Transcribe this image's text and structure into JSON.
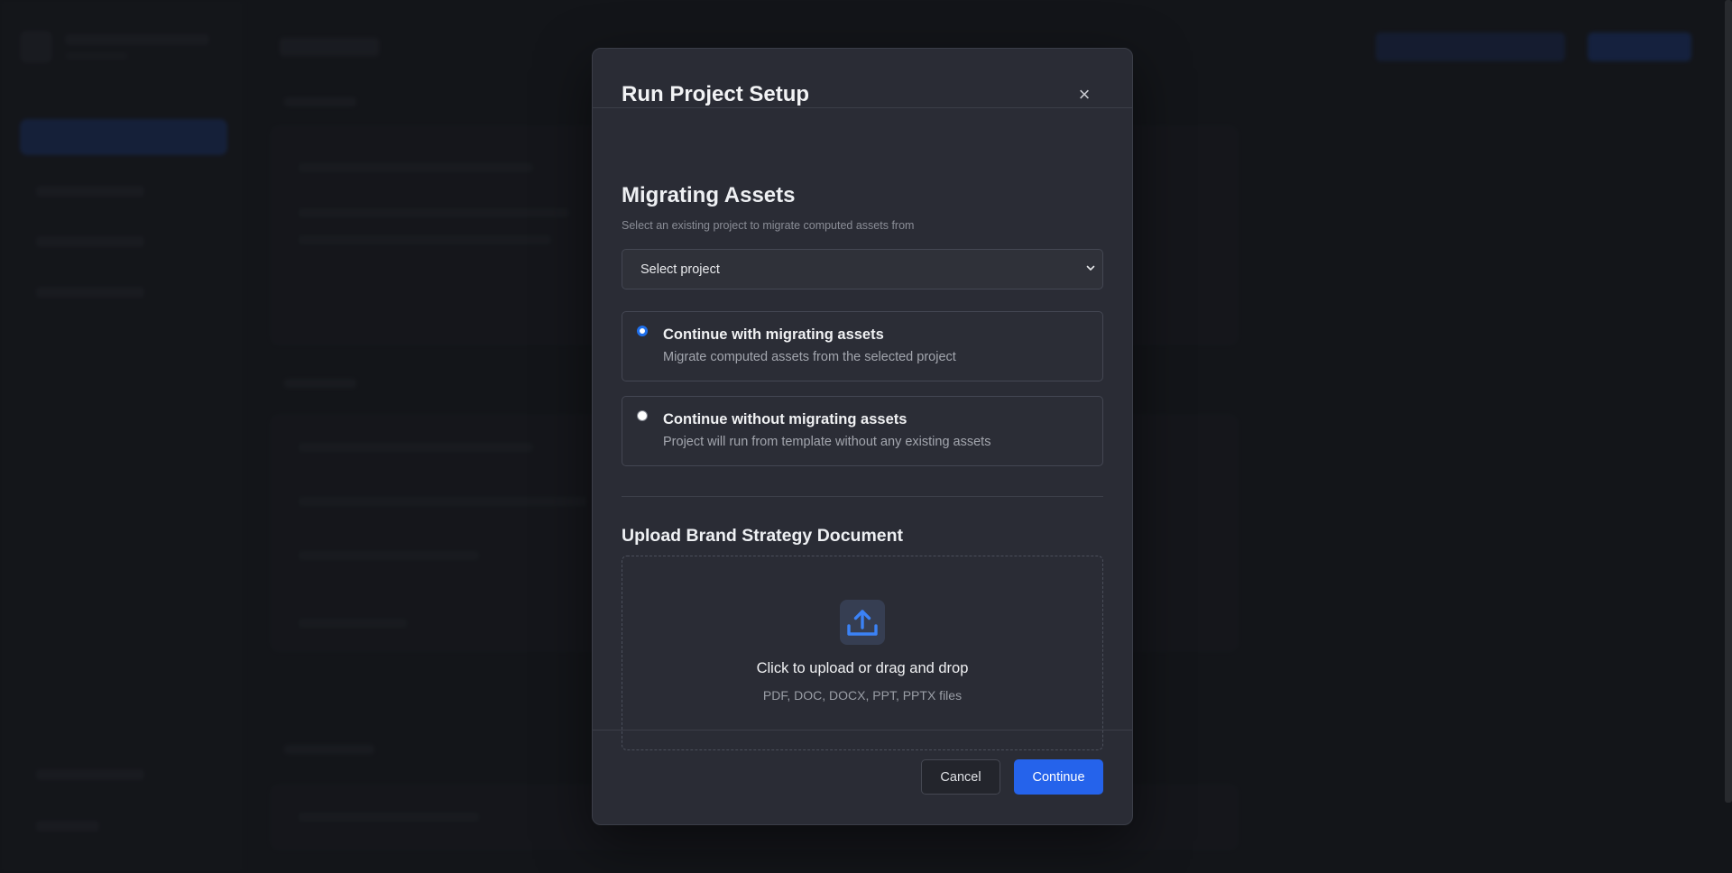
{
  "modal": {
    "title": "Run Project Setup",
    "close_icon": "close-icon"
  },
  "migrating": {
    "heading": "Migrating Assets",
    "description": "Select an existing project to migrate computed assets from",
    "select": {
      "value": "Select project",
      "icon": "chevron-down-icon"
    },
    "options": [
      {
        "title": "Continue with migrating assets",
        "description": "Migrate computed assets from the selected project",
        "checked": true
      },
      {
        "title": "Continue without migrating assets",
        "description": "Project will run from template without any existing assets",
        "checked": false
      }
    ]
  },
  "upload": {
    "heading": "Upload Brand Strategy Document",
    "icon": "upload-icon",
    "prompt": "Click to upload or drag and drop",
    "formats": "PDF, DOC, DOCX, PPT, PPTX files"
  },
  "footer": {
    "cancel_label": "Cancel",
    "continue_label": "Continue"
  },
  "colors": {
    "accent": "#2563eb",
    "modal_bg": "#2a2c35",
    "page_bg": "#1a1b20"
  }
}
